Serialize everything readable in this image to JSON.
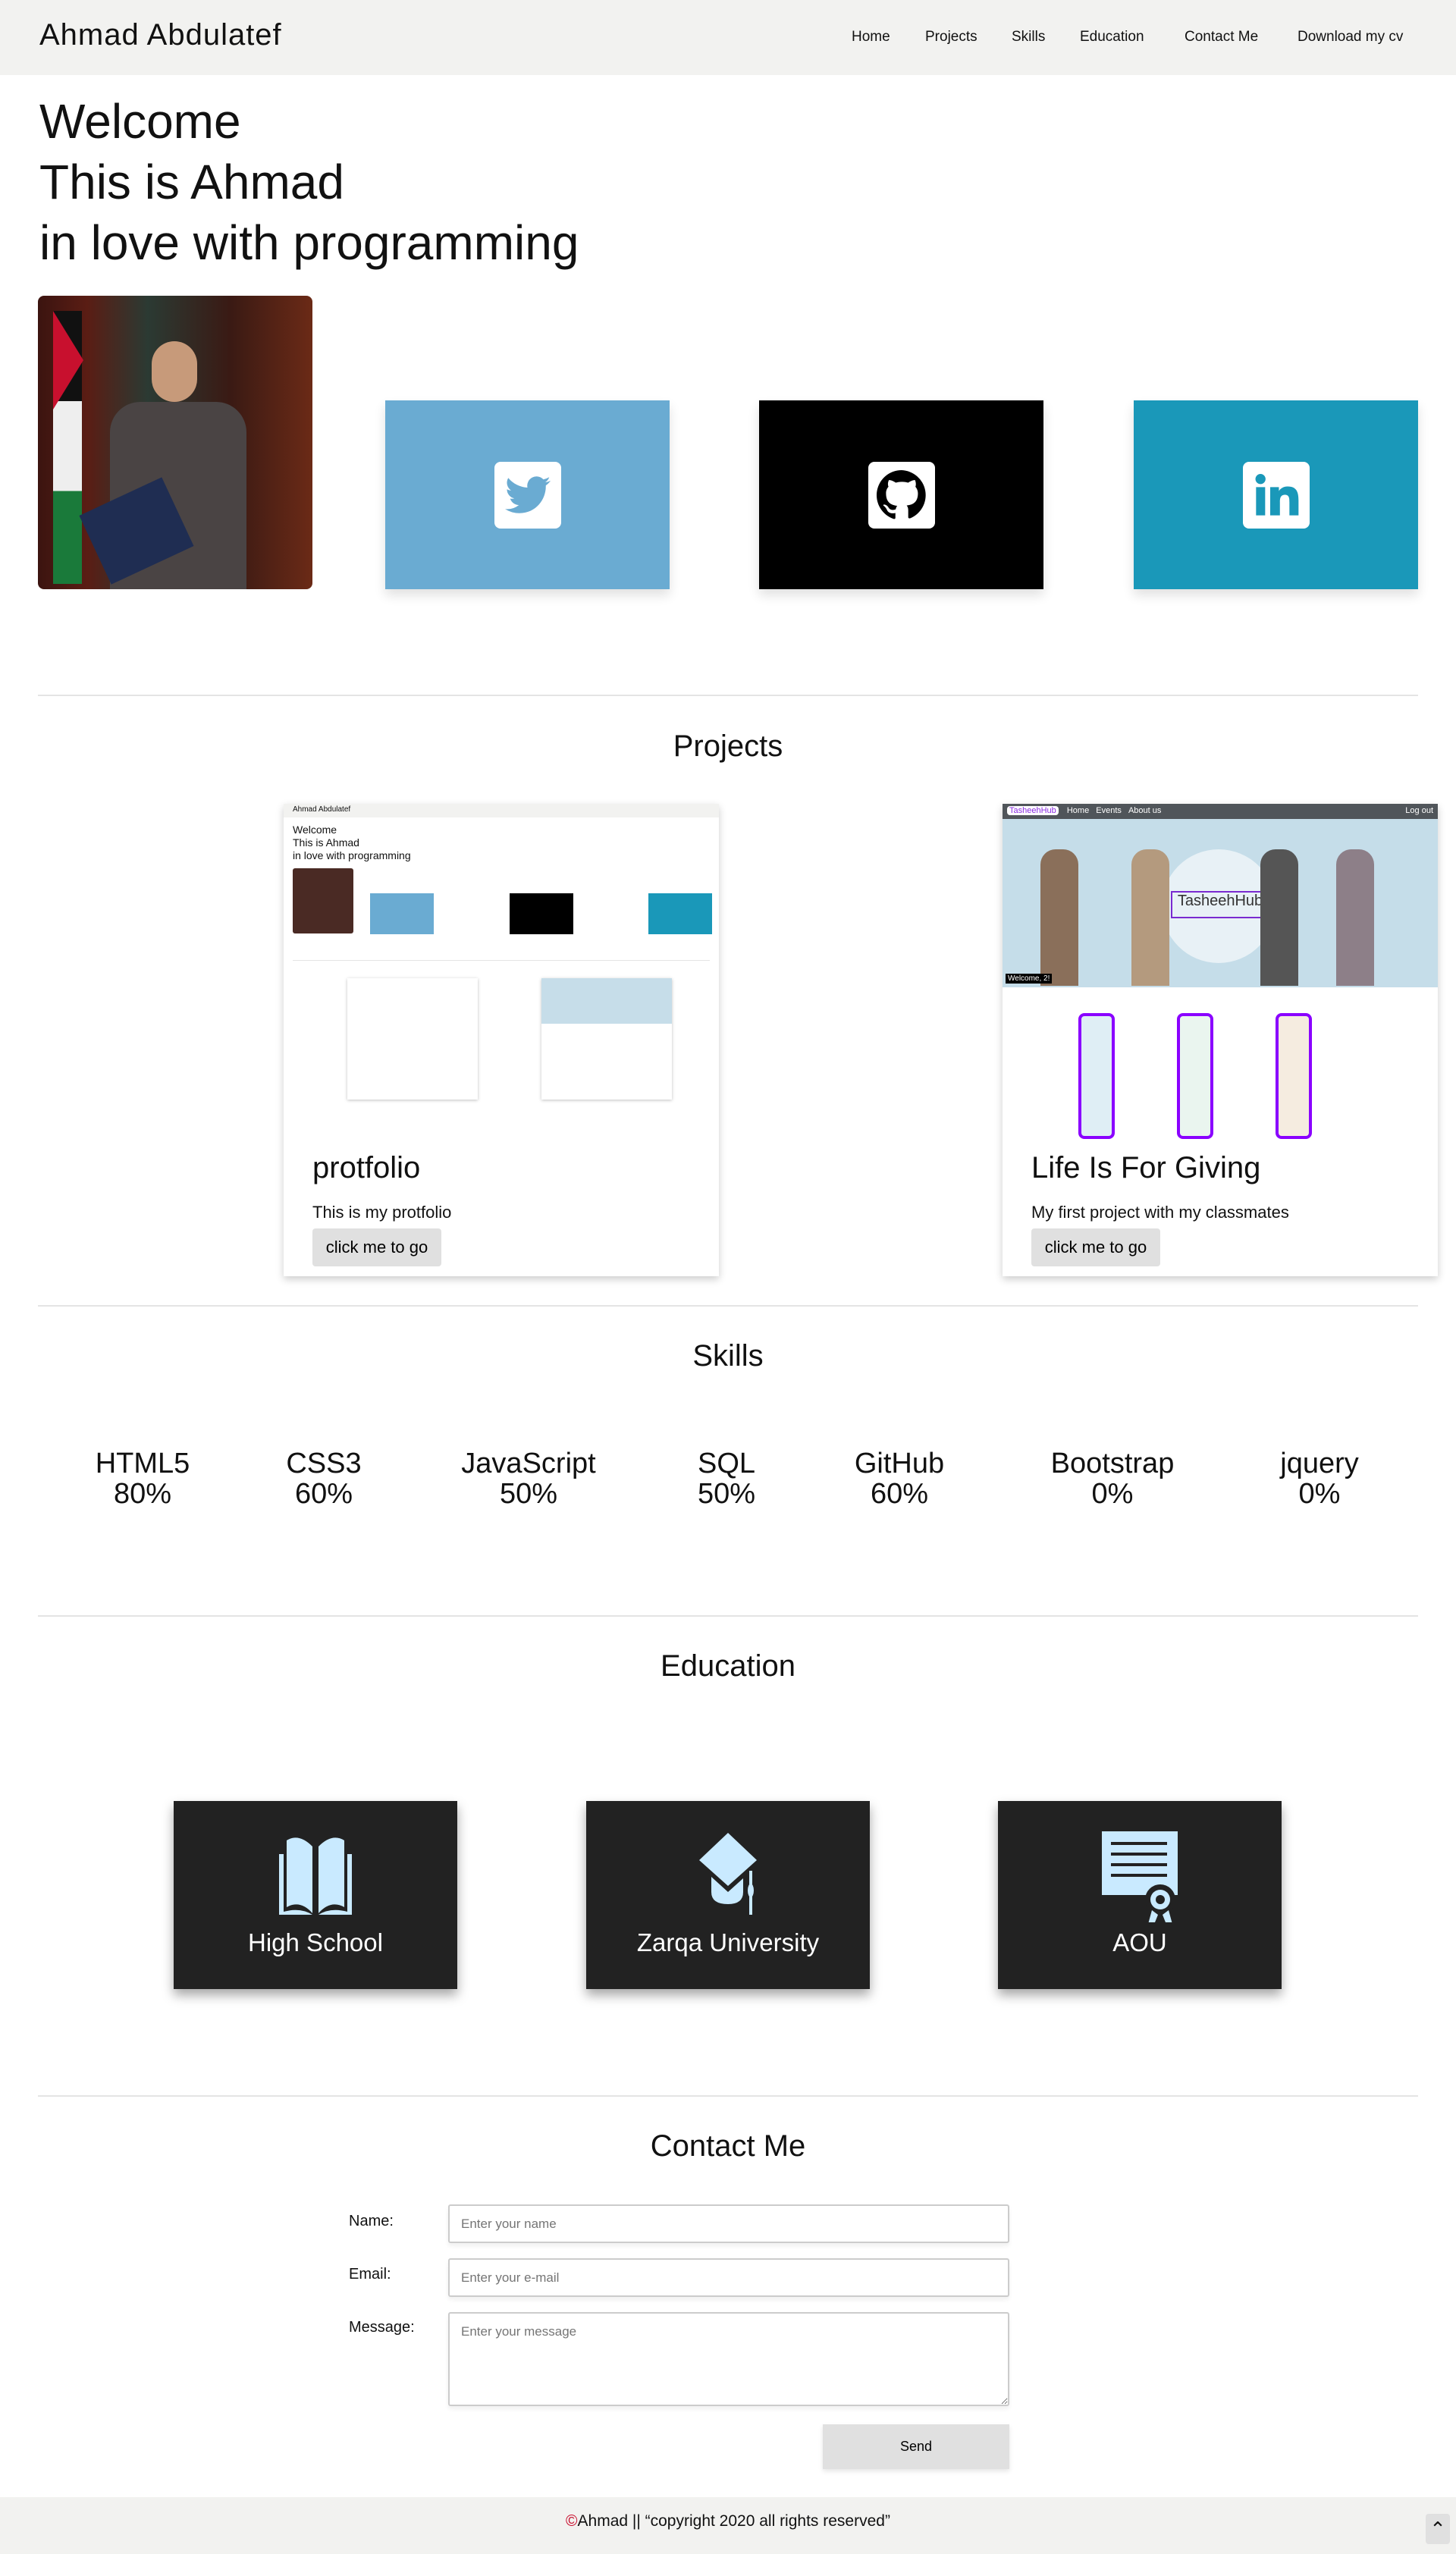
{
  "header": {
    "logo": "Ahmad Abdulatef",
    "nav": [
      "Home",
      "Projects",
      "Skills",
      "Education",
      "Contact Me",
      "Download my cv"
    ]
  },
  "hero": {
    "lines": [
      "Welcome",
      "This is Ahmad",
      "in love with programming"
    ]
  },
  "social": [
    {
      "name": "twitter",
      "icon": "twitter-icon",
      "color": "#6aabd2"
    },
    {
      "name": "github",
      "icon": "github-icon",
      "color": "#000000"
    },
    {
      "name": "linkedin",
      "icon": "linkedin-icon",
      "color": "#1a98b9"
    }
  ],
  "projects": {
    "heading": "Projects",
    "items": [
      {
        "title": "protfolio",
        "desc": "This is my protfolio",
        "button": "click me to go",
        "preview_logo": "Ahmad Abdulatef",
        "preview_lines": [
          "Welcome",
          "This is Ahmad",
          "in love with programming"
        ]
      },
      {
        "title": "Life Is For Giving",
        "desc": "My first project with my classmates",
        "button": "click me to go",
        "preview_brand": "TasheehHub",
        "preview_nav": [
          "Home",
          "Events",
          "About us"
        ],
        "preview_logout": "Log out",
        "preview_welcome": "Welcome, 2!"
      }
    ]
  },
  "skills": {
    "heading": "Skills",
    "items": [
      {
        "name": "HTML5",
        "pct": "80%"
      },
      {
        "name": "CSS3",
        "pct": "60%"
      },
      {
        "name": "JavaScript",
        "pct": "50%"
      },
      {
        "name": "SQL",
        "pct": "50%"
      },
      {
        "name": "GitHub",
        "pct": "60%"
      },
      {
        "name": "Bootstrap",
        "pct": "0%"
      },
      {
        "name": "jquery",
        "pct": "0%"
      }
    ]
  },
  "education": {
    "heading": "Education",
    "items": [
      "High School",
      "Zarqa University",
      "AOU"
    ],
    "icon_color": "#c9eaff"
  },
  "contact": {
    "heading": "Contact Me",
    "name_label": "Name:",
    "name_ph": "Enter your name",
    "email_label": "Email:",
    "email_ph": "Enter your e-mail",
    "msg_label": "Message:",
    "msg_ph": "Enter your message",
    "send": "Send"
  },
  "footer": {
    "text": "Ahmad || “copyright 2020 all rights reserved”"
  }
}
